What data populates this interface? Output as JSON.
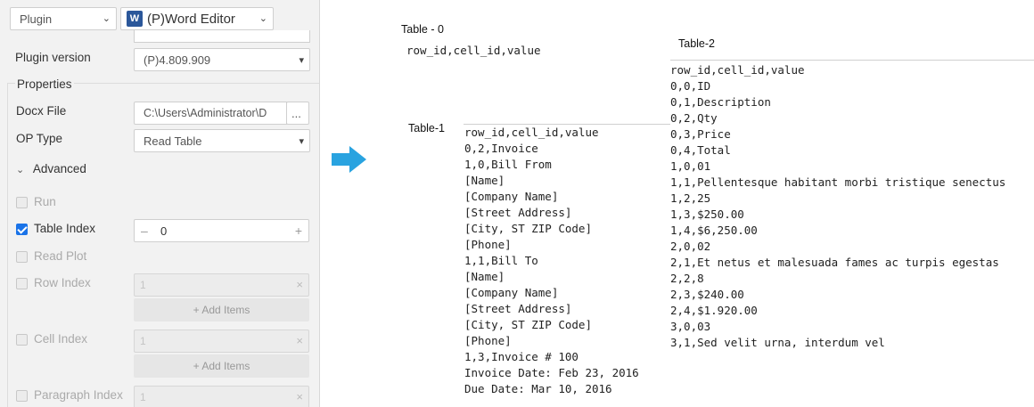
{
  "panel": {
    "type_select": "Plugin",
    "plugin_select": "(P)Word Editor",
    "plugin_version_label": "Plugin version",
    "plugin_version_value": "(P)4.809.909",
    "properties_label": "Properties",
    "docx_file_label": "Docx File",
    "docx_file_value": "C:\\Users\\Administrator\\D",
    "browse_label": "...",
    "op_type_label": "OP Type",
    "op_type_value": "Read Table",
    "advanced_label": "Advanced",
    "run_label": "Run",
    "table_index_label": "Table Index",
    "table_index_value": "0",
    "read_plot_label": "Read Plot",
    "row_index_label": "Row Index",
    "row_index_value": "1",
    "add_items_label": "+ Add Items",
    "cell_index_label": "Cell Index",
    "cell_index_value": "1",
    "add_items_label_2": "+ Add Items",
    "paragraph_index_label": "Paragraph Index",
    "paragraph_index_value": "1"
  },
  "results": {
    "table0": {
      "title": "Table - 0",
      "text": "row_id,cell_id,value"
    },
    "table1": {
      "title": "Table-1",
      "text": "row_id,cell_id,value\n0,2,Invoice\n1,0,Bill From\n[Name]\n[Company Name]\n[Street Address]\n[City, ST ZIP Code]\n[Phone]\n1,1,Bill To\n[Name]\n[Company Name]\n[Street Address]\n[City, ST ZIP Code]\n[Phone]\n1,3,Invoice # 100\nInvoice Date: Feb 23, 2016\nDue Date: Mar 10, 2016"
    },
    "table2": {
      "title": "Table-2",
      "text": "row_id,cell_id,value\n0,0,ID\n0,1,Description\n0,2,Qty\n0,3,Price\n0,4,Total\n1,0,01\n1,1,Pellentesque habitant morbi tristique senectus\n1,2,25\n1,3,$250.00\n1,4,$6,250.00\n2,0,02\n2,1,Et netus et malesuada fames ac turpis egestas\n2,2,8\n2,3,$240.00\n2,4,$1.920.00\n3,0,03\n3,1,Sed velit urna, interdum vel"
    }
  },
  "colors": {
    "arrow": "#29a3e0",
    "checkbox": "#1a73e8",
    "word_icon": "#2b579a"
  }
}
